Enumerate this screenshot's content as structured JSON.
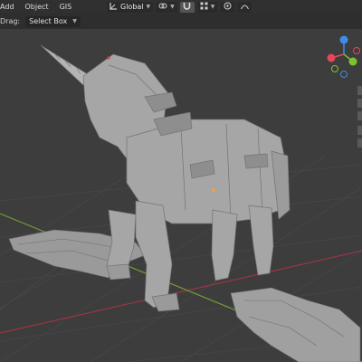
{
  "menu": {
    "items": [
      {
        "label": "Add"
      },
      {
        "label": "Object"
      },
      {
        "label": "GIS"
      }
    ]
  },
  "header": {
    "transform_orientation": "Global",
    "transform_icon": "transform-orientation-icon",
    "pivot_icon": "pivot-link-icon",
    "snap_icon": "snap-magnet-icon",
    "snap_grid_icon": "snap-grid-icon",
    "proportional_icon": "proportional-edit-icon",
    "curve_icon": "falloff-curve-icon"
  },
  "sub_header": {
    "drag_label": "Drag:",
    "select_mode": "Select Box"
  },
  "gizmo": {
    "axes": [
      "X",
      "Y",
      "Z"
    ],
    "colors": {
      "x": "#e8455a",
      "y": "#7cc22f",
      "z": "#3f8ce6"
    }
  },
  "viewport": {
    "background": "#3d3d3d",
    "grid_color": "#4a4a4a",
    "x_axis_color": "#a83a48",
    "y_axis_color": "#7aa33a",
    "model_color": "#a6a6a6",
    "model": "unicorn"
  }
}
